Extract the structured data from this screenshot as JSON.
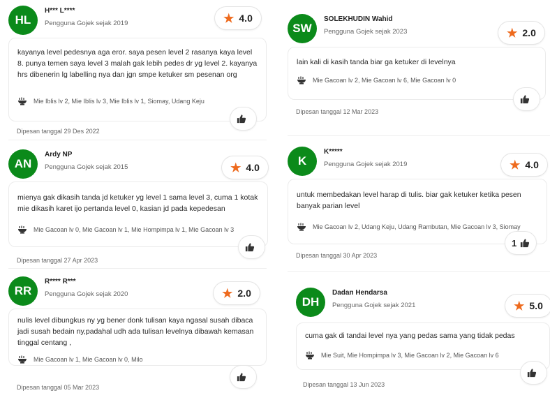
{
  "reviews": [
    {
      "initials": "HL",
      "name": "H*** L****",
      "since": "Pengguna Gojek sejak 2019",
      "rating": "4.0",
      "text": "kayanya level pedesnya aga eror. saya pesen level 2 rasanya kaya level 8. punya temen saya level 3 malah gak lebih pedes dr yg level 2. kayanya hrs dibenerin lg labelling nya dan jgn smpe ketuker sm pesenan org",
      "items": "Mie Iblis lv 2, Mie Iblis lv 3, Mie Iblis lv 1, Siomay, Udang Keju",
      "likes": "",
      "date": "Dipesan tanggal 29 Des 2022"
    },
    {
      "initials": "AN",
      "name": "Ardy NP",
      "since": "Pengguna Gojek sejak 2015",
      "rating": "4.0",
      "text": "mienya gak dikasih tanda jd ketuker yg level 1 sama level 3, cuma 1 kotak mie dikasih karet ijo pertanda level 0, kasian jd pada kepedesan",
      "items": "Mie Gacoan lv 0, Mie Gacoan lv 1, Mie Hompimpa lv 1, Mie Gacoan lv 3",
      "likes": "",
      "date": "Dipesan tanggal 27 Apr 2023"
    },
    {
      "initials": "RR",
      "name": "R**** R***",
      "since": "Pengguna Gojek sejak 2020",
      "rating": "2.0",
      "text": "nulis level dibungkus ny yg bener donk tulisan kaya ngasal susah dibaca jadi susah bedain ny,padahal udh ada tulisan levelnya dibawah kemasan tinggal centang ,",
      "items": "Mie Gacoan lv 1, Mie Gacoan lv 0, Milo",
      "likes": "",
      "date": "Dipesan tanggal 05 Mar 2023"
    },
    {
      "initials": "SW",
      "name": "SOLEKHUDIN Wahid",
      "since": "Pengguna Gojek sejak 2023",
      "rating": "2.0",
      "text": "lain kali di kasih tanda biar ga ketuker di levelnya",
      "items": "Mie Gacoan lv 2, Mie Gacoan lv 6, Mie Gacoan lv 0",
      "likes": "",
      "date": "Dipesan tanggal 12 Mar 2023"
    },
    {
      "initials": "K",
      "name": "K*****",
      "since": "Pengguna Gojek sejak 2019",
      "rating": "4.0",
      "text": "untuk membedakan level harap di tulis. biar gak ketuker ketika pesen banyak parian level",
      "items": "Mie Gacoan lv 2, Udang Keju, Udang Rambutan, Mie Gacoan lv 3, Siomay",
      "likes": "1",
      "date": "Dipesan tanggal 30 Apr 2023"
    },
    {
      "initials": "DH",
      "name": "Dadan Hendarsa",
      "since": "Pengguna Gojek sejak 2021",
      "rating": "5.0",
      "text": "cuma gak di tandai level nya yang pedas sama yang tidak pedas",
      "items": "Mie Suit, Mie Hompimpa lv 3, Mie Gacoan lv 2, Mie Gacoan lv 6",
      "likes": "",
      "date": "Dipesan tanggal 13 Jun 2023"
    }
  ],
  "icons": {
    "rating": "star-icon",
    "menu": "bowl-icon",
    "like": "thumbs-up-icon"
  },
  "colors": {
    "avatar": "#0b8a1a",
    "star": "#ee6a1d"
  }
}
